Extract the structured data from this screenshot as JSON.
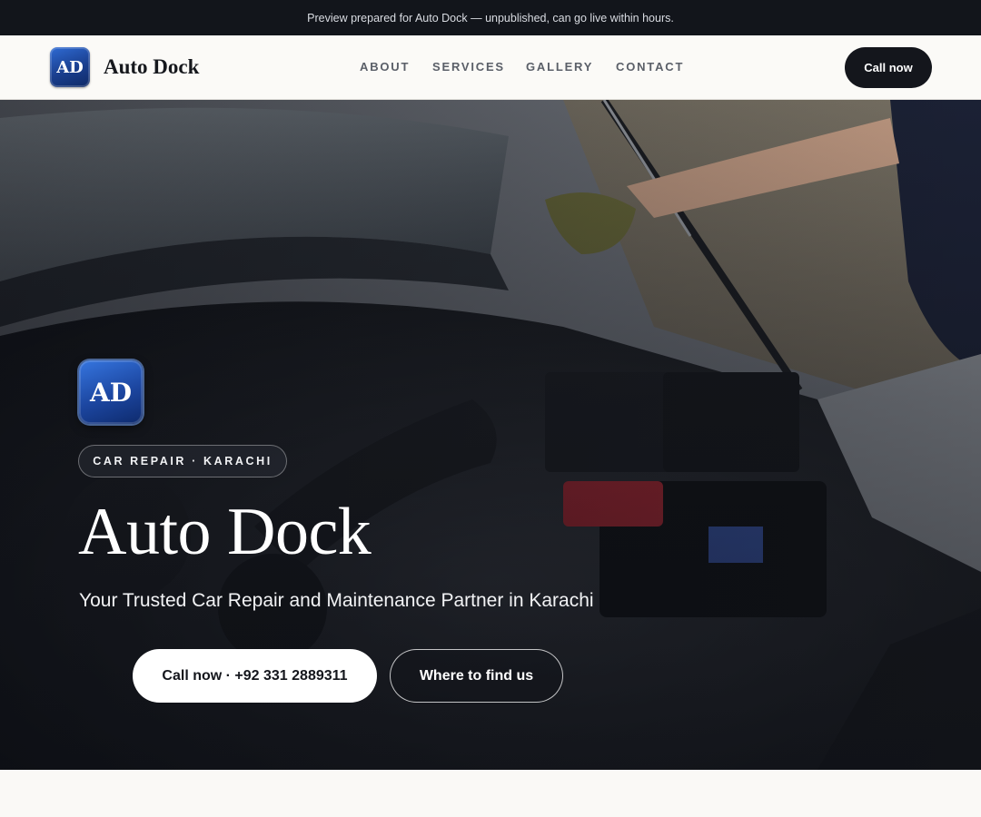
{
  "preview_banner": {
    "text": "Preview prepared for Auto Dock — unpublished, can go live within hours."
  },
  "header": {
    "logo_text": "AD",
    "brand_name": "Auto Dock",
    "nav": [
      "ABOUT",
      "SERVICES",
      "GALLERY",
      "CONTACT"
    ],
    "call_label": "Call now"
  },
  "hero": {
    "logo_text": "AD",
    "tag": "CAR REPAIR · KARACHI",
    "title": "Auto Dock",
    "subtitle": "Your Trusted Car Repair and Maintenance Partner in Karachi",
    "primary_cta": "Call now · +92 331 2889311",
    "secondary_cta": "Where to find us"
  },
  "colors": {
    "banner_bg": "#12151b",
    "header_bg": "#fbfaf7",
    "accent_dark": "#14161c",
    "logo_blue": "#1a3f8f",
    "page_bg": "#faf9f6"
  }
}
